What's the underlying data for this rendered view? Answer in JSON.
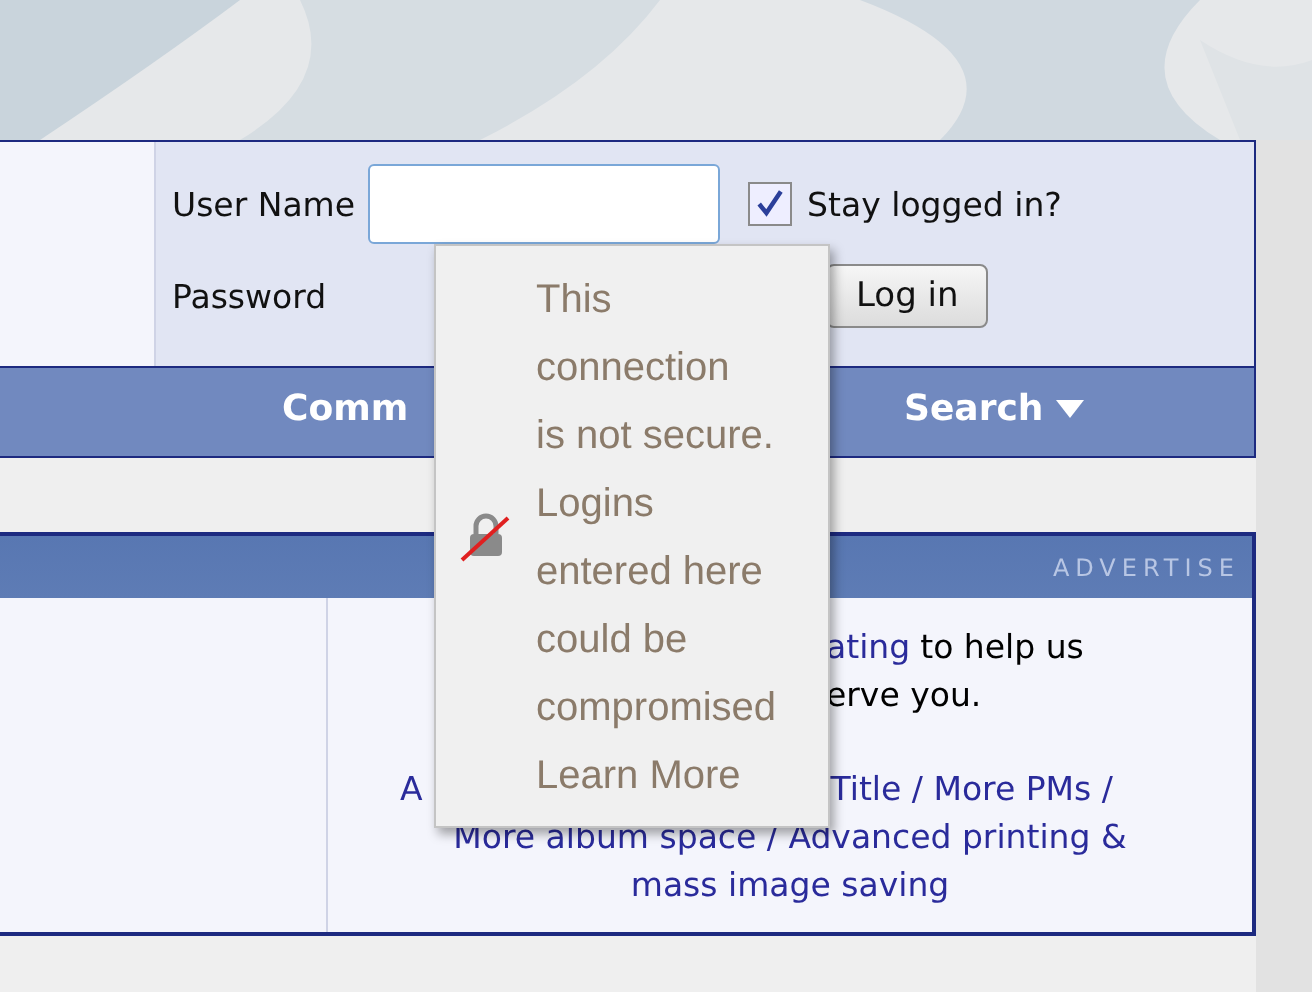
{
  "login": {
    "username_label": "User Name",
    "stay_logged_in": {
      "label": "Stay logged in?",
      "checked": true
    },
    "password_label": "Password",
    "login_button": "Log in"
  },
  "nav": [
    {
      "label": "Comm",
      "dropdown": false
    },
    {
      "label": "Search",
      "dropdown": true
    }
  ],
  "ad": {
    "header": "ADVERTISE",
    "lines": [
      {
        "segments": [
          {
            "kind": "link",
            "text": "ating"
          },
          {
            "kind": "text",
            "text": "to help us"
          }
        ]
      },
      {
        "segments": [
          {
            "kind": "text",
            "text": "erve you."
          }
        ]
      },
      {
        "segments": [
          {
            "kind": "link",
            "text": "A"
          },
          {
            "kind": "link",
            "text": "Title / More PMs /"
          }
        ]
      },
      {
        "segments": [
          {
            "kind": "link",
            "text": "More album space / Advanced printing &"
          }
        ]
      },
      {
        "segments": [
          {
            "kind": "link",
            "text": "mass image saving"
          }
        ]
      }
    ]
  },
  "popup": {
    "message_lines": [
      "This",
      "connection",
      "is not secure.",
      "Logins",
      "entered here",
      "could be",
      "compromised"
    ],
    "link": "Learn More"
  }
}
